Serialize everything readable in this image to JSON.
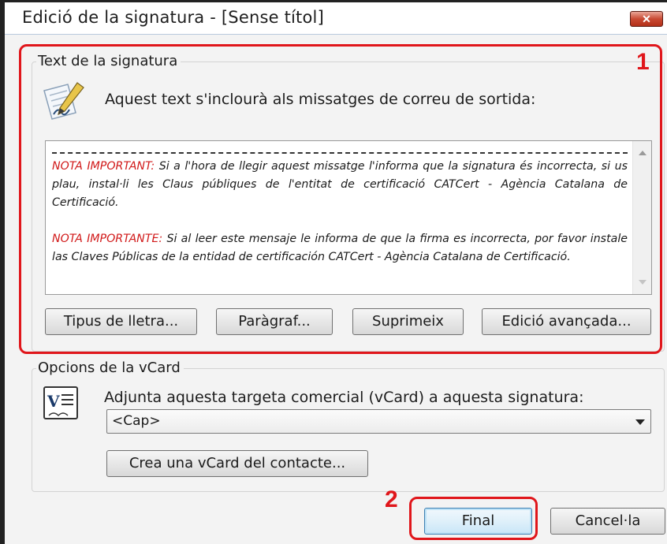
{
  "window": {
    "title": "Edició de la signatura - [Sense títol]",
    "close_glyph": "✕"
  },
  "signature_group": {
    "legend": "Text de la signatura",
    "description": "Aquest text s'inclourà als missatges de correu de sortida:",
    "editor": {
      "separator": "------------------------------------------------------------------------",
      "note_ca_label": "NOTA IMPORTANT:",
      "note_ca_text": " Si a l'hora de llegir aquest missatge l'informa que la signatura és incorrecta, si us plau, instal·li les  Claus públiques  de l'entitat de certificació CATCert - Agència Catalana de Certificació.",
      "note_es_label": "NOTA IMPORTANTE:",
      "note_es_text": " Si al leer este mensaje le informa  de que la firma es incorrecta, por favor instale las  Claves Públicas de la entidad de certificación CATCert - Agència Catalana de Certificació."
    },
    "buttons": {
      "font": "Tipus de lletra...",
      "paragraph": "Paràgraf...",
      "delete": "Suprimeix",
      "advanced": "Edició avançada..."
    }
  },
  "vcard_group": {
    "legend": "Opcions de la vCard",
    "description": "Adjunta aquesta targeta comercial (vCard) a aquesta signatura:",
    "select_value": "<Cap>",
    "create_button": "Crea una vCard del contacte..."
  },
  "footer": {
    "final_button": "Final",
    "cancel_button": "Cancel·la"
  },
  "annotations": {
    "marker_1": "1",
    "marker_2": "2",
    "color": "#e0161b"
  },
  "icons": [
    "signature-edit-icon",
    "vcard-icon",
    "close-icon",
    "scroll-up-icon",
    "scroll-down-icon",
    "dropdown-arrow-icon"
  ]
}
